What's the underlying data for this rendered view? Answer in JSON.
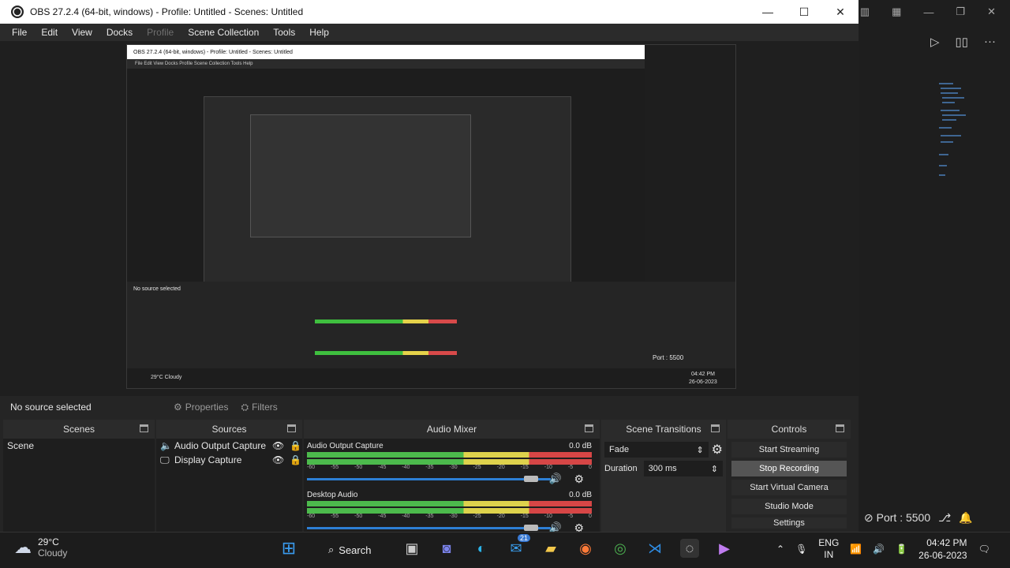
{
  "window": {
    "title": "OBS 27.2.4 (64-bit, windows) - Profile: Untitled - Scenes: Untitled"
  },
  "menu": [
    "File",
    "Edit",
    "View",
    "Docks",
    "Profile",
    "Scene Collection",
    "Tools",
    "Help"
  ],
  "inner": {
    "title": "OBS 27.2.4 (64-bit, windows) - Profile: Untitled - Scenes: Untitled",
    "menu": "File  Edit  View  Docks  Profile  Scene Collection  Tools  Help",
    "nosel": "No source selected",
    "port": "Port : 5500",
    "weather": "29°C Cloudy",
    "time": "04:42 PM",
    "date": "26-06-2023"
  },
  "propbar": {
    "no_source": "No source selected",
    "properties": "Properties",
    "filters": "Filters"
  },
  "docks": {
    "scenes": {
      "title": "Scenes",
      "items": [
        "Scene"
      ]
    },
    "sources": {
      "title": "Sources",
      "items": [
        "Audio Output Capture",
        "Display Capture"
      ]
    },
    "mixer": {
      "title": "Audio Mixer",
      "channels": [
        {
          "name": "Audio Output Capture",
          "db": "0.0 dB"
        },
        {
          "name": "Desktop Audio",
          "db": "0.0 dB"
        }
      ],
      "ticks": [
        "-60",
        "-55",
        "-50",
        "-45",
        "-40",
        "-35",
        "-30",
        "-25",
        "-20",
        "-15",
        "-10",
        "-5",
        "0"
      ]
    },
    "transitions": {
      "title": "Scene Transitions",
      "type": "Fade",
      "duration_label": "Duration",
      "duration": "300 ms"
    },
    "controls": {
      "title": "Controls",
      "buttons": [
        "Start Streaming",
        "Stop Recording",
        "Start Virtual Camera",
        "Studio Mode",
        "Settings"
      ],
      "active": 1
    }
  },
  "statusbar": {
    "port": "Port : 5500"
  },
  "taskbar": {
    "temp": "29°C",
    "cond": "Cloudy",
    "search": "Search",
    "lang1": "ENG",
    "lang2": "IN",
    "time": "04:42 PM",
    "date": "26-06-2023",
    "badge": "21"
  },
  "colors": {
    "accent": "#2d7fd5",
    "meter_green": "#4ec24e",
    "meter_yellow": "#e8dc4e",
    "meter_red": "#e04848"
  }
}
